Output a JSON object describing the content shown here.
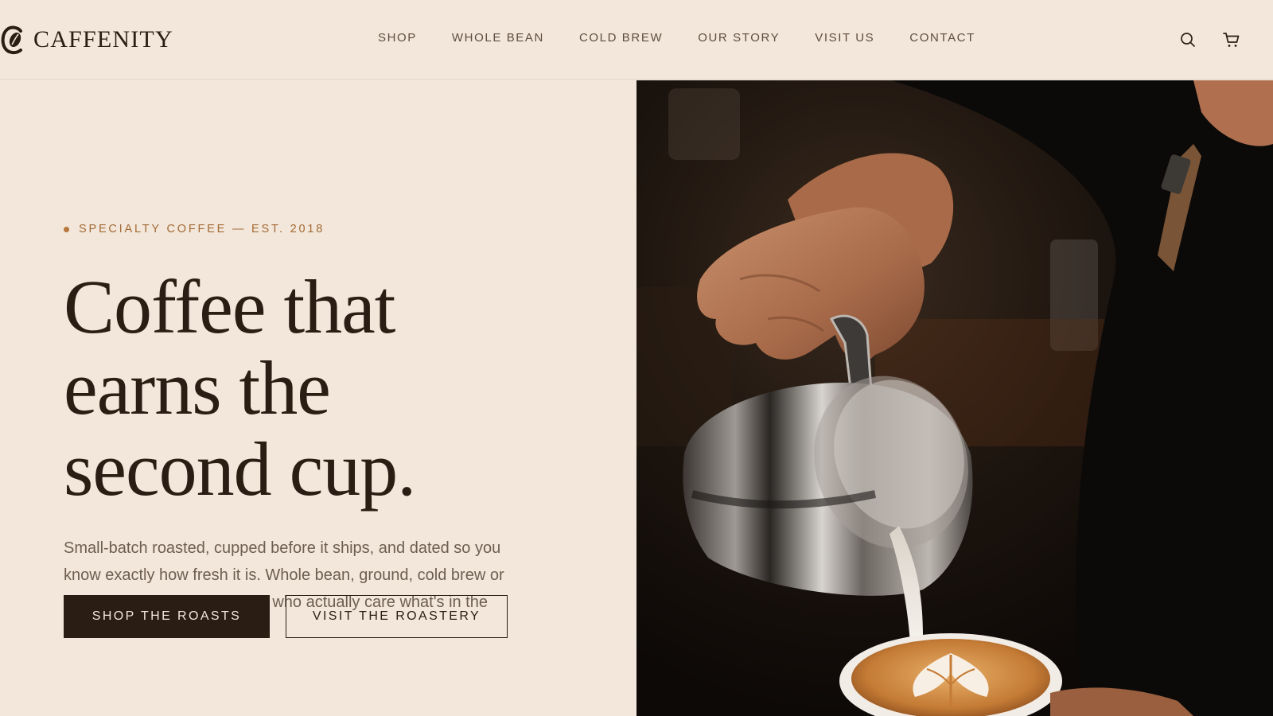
{
  "brand": {
    "name": "CAFFENITY"
  },
  "nav": {
    "items": [
      {
        "label": "SHOP"
      },
      {
        "label": "WHOLE BEAN"
      },
      {
        "label": "COLD BREW"
      },
      {
        "label": "OUR STORY"
      },
      {
        "label": "VISIT US"
      },
      {
        "label": "CONTACT"
      }
    ]
  },
  "header_icons": {
    "search": "search-icon",
    "cart": "cart-icon"
  },
  "hero": {
    "eyebrow": "SPECIALTY COFFEE — EST. 2018",
    "headline": [
      "Coffee that",
      "earns the",
      "second cup."
    ],
    "lede": "Small-batch roasted, cupped before it ships, and dated so you know exactly how fresh it is. Whole bean, ground, cold brew or espresso — made for people who actually care what's in the cup.",
    "primary_cta": "SHOP THE ROASTS",
    "secondary_cta": "VISIT THE ROASTERY",
    "image": "barista pouring latte art"
  },
  "colors": {
    "background": "#f2e7da",
    "text_dark": "#2a1d14",
    "accent": "#b7773d",
    "muted": "#6e5e52"
  }
}
